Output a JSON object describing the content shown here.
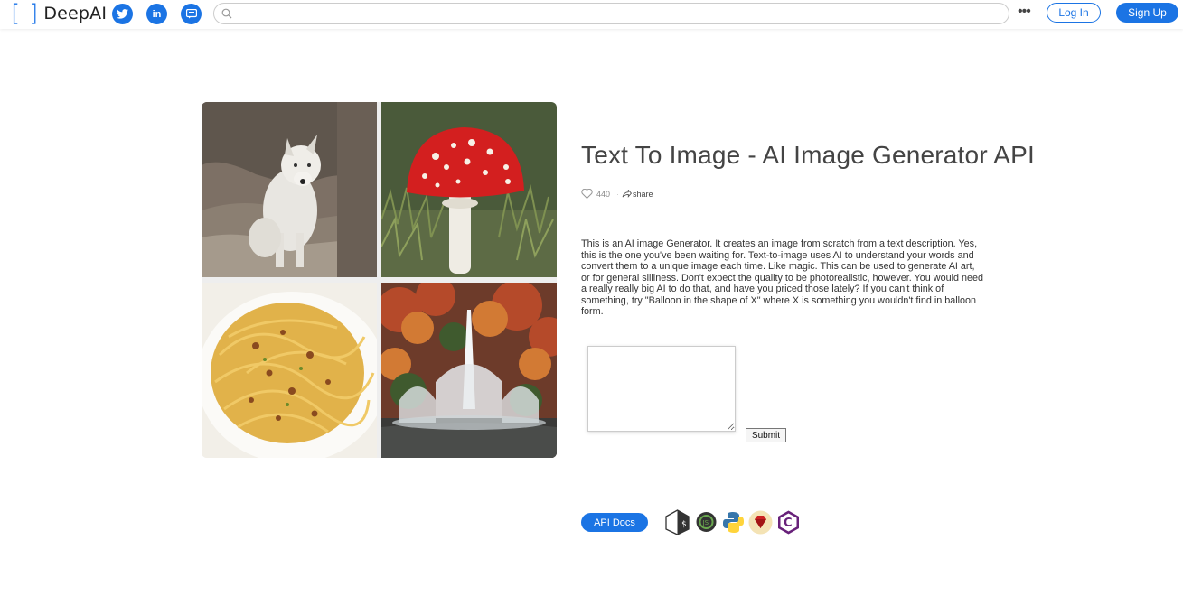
{
  "header": {
    "logo_text": "DeepAI",
    "social": [
      {
        "name": "twitter-icon",
        "glyph": "t"
      },
      {
        "name": "linkedin-icon",
        "glyph": "in"
      },
      {
        "name": "chat-icon",
        "glyph": "▭"
      }
    ],
    "search": {
      "placeholder": "",
      "value": ""
    },
    "more_label": "•••",
    "login_label": "Log In",
    "signup_label": "Sign Up"
  },
  "gallery": {
    "images": [
      "white-wolf-image",
      "red-mushroom-image",
      "pasta-image",
      "fountain-image"
    ]
  },
  "main": {
    "title": "Text To Image - AI Image Generator API",
    "likes": "440",
    "share_label": "share",
    "description": "This is an AI image Generator. It creates an image from scratch from a text description. Yes, this is the one you've been waiting for. Text-to-image uses AI to understand your words and convert them to a unique image each time. Like magic. This can be used to generate AI art, or for general silliness. Don't expect the quality to be photorealistic, however. You would need a really really big AI to do that, and have you priced those lately? If you can't think of something, try \"Balloon in the shape of X\" where X is something you wouldn't find in balloon form.",
    "prompt_value": "",
    "submit_label": "Submit",
    "api_docs_label": "API Docs",
    "languages": [
      "shell-icon",
      "nodejs-icon",
      "python-icon",
      "ruby-icon",
      "csharp-icon"
    ]
  },
  "colors": {
    "accent": "#1b74e4",
    "title": "#444444"
  }
}
